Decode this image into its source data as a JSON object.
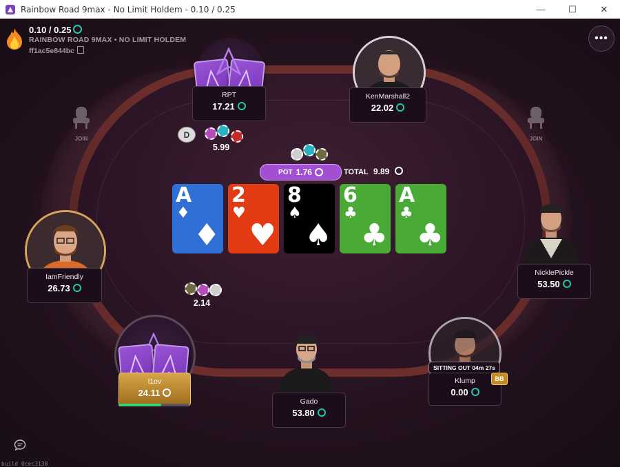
{
  "window": {
    "title": "Rainbow Road 9max - No Limit Holdem - 0.10 / 0.25",
    "controls": [
      "—",
      "☐",
      "✕"
    ]
  },
  "header": {
    "stakes": "0.10 / 0.25",
    "table_name": "RAINBOW ROAD 9MAX • NO LIMIT HOLDEM",
    "table_id": "ff1ac5e844bc"
  },
  "menu_button": "•••",
  "empty_seats": [
    {
      "label": "JOIN"
    },
    {
      "label": "JOIN"
    }
  ],
  "players": [
    {
      "name": "RPT",
      "stack": "17.21"
    },
    {
      "name": "KenMarshall2",
      "stack": "22.02"
    },
    {
      "name": "IamFriendly",
      "stack": "26.73"
    },
    {
      "name": "NicklePickle",
      "stack": "53.50"
    },
    {
      "name": "l1ov",
      "stack": "24.11"
    },
    {
      "name": "Gado",
      "stack": "53.80"
    },
    {
      "name": "Klump",
      "stack": "0.00",
      "status": "SITTING OUT 04m 27s",
      "badge": "BB"
    }
  ],
  "hero_timer_fraction": 0.6,
  "dealer_button": "D",
  "bets": [
    {
      "amount": "5.99"
    },
    {
      "amount": "2.14"
    }
  ],
  "pot": {
    "label": "POT",
    "amount": "1.76"
  },
  "total": {
    "label": "TOTAL",
    "amount": "9.89"
  },
  "board": [
    {
      "rank": "A",
      "suit": "♦",
      "color": "#2f6fd6"
    },
    {
      "rank": "2",
      "suit": "♥",
      "color": "#e23a12"
    },
    {
      "rank": "8",
      "suit": "♠",
      "color": "#000000"
    },
    {
      "rank": "6",
      "suit": "♣",
      "color": "#4aaa36"
    },
    {
      "rank": "A",
      "suit": "♣",
      "color": "#4aaa36"
    }
  ],
  "build": "build 0cec3138"
}
